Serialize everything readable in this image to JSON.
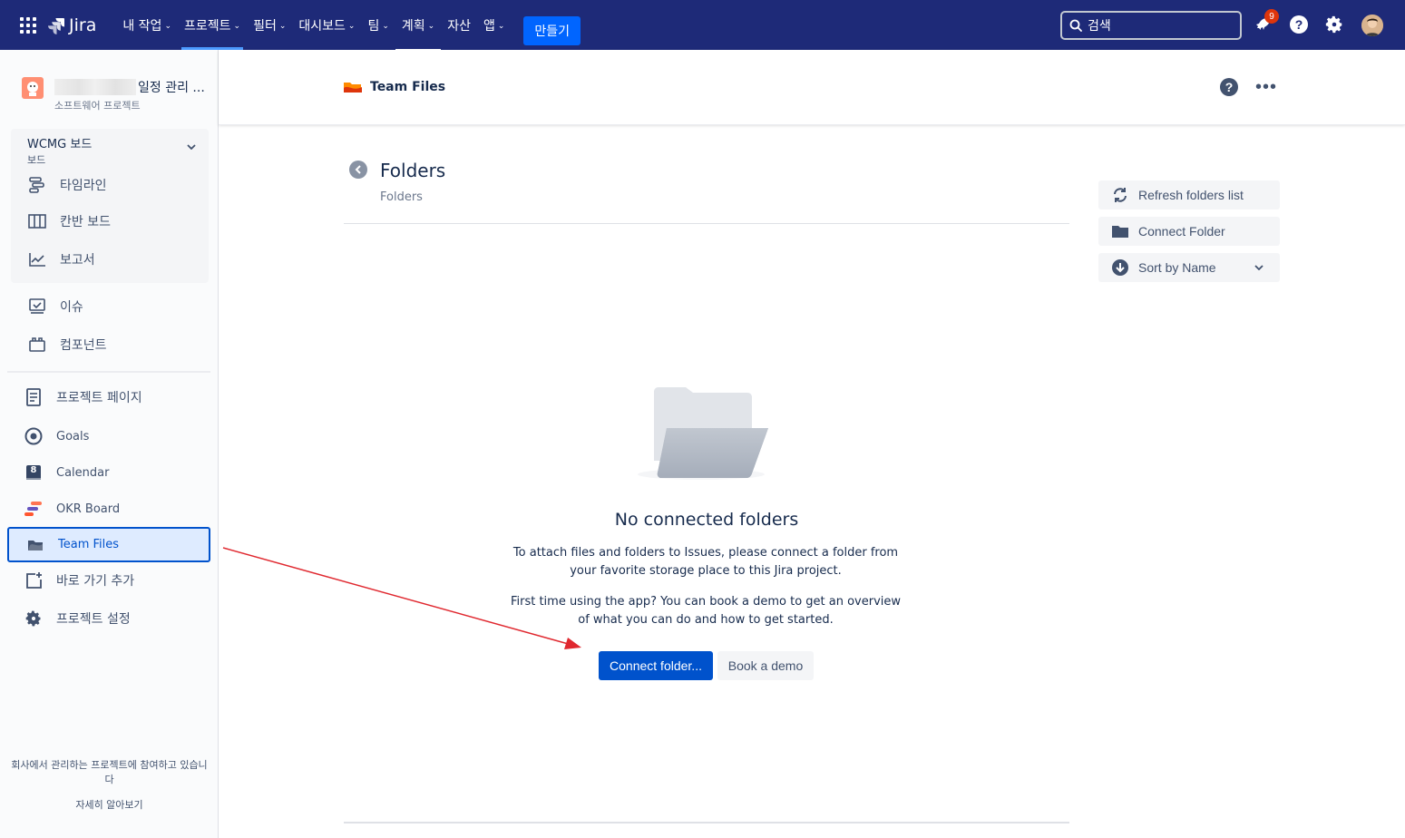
{
  "topnav": {
    "app_name": "Jira",
    "menu": [
      {
        "label": "내 작업",
        "chevron": true
      },
      {
        "label": "프로젝트",
        "chevron": true
      },
      {
        "label": "필터",
        "chevron": true
      },
      {
        "label": "대시보드",
        "chevron": true
      },
      {
        "label": "팀",
        "chevron": true
      },
      {
        "label": "계획",
        "chevron": true
      },
      {
        "label": "자산",
        "chevron": false
      },
      {
        "label": "앱",
        "chevron": true
      }
    ],
    "create_label": "만들기",
    "search_placeholder": "검색",
    "notification_count": "9",
    "accent": "#1e2a78"
  },
  "sidebar": {
    "project_title": "일정 관리 ...",
    "project_subtitle": "소프트웨어 프로젝트",
    "board": {
      "name": "WCMG 보드",
      "subtitle": "보드",
      "items": [
        {
          "label": "타임라인",
          "icon": "timeline-icon"
        },
        {
          "label": "칸반 보드",
          "icon": "board-icon"
        },
        {
          "label": "보고서",
          "icon": "reports-icon"
        }
      ]
    },
    "items": [
      {
        "label": "이슈",
        "icon": "issues-icon"
      },
      {
        "label": "컴포넌트",
        "icon": "components-icon"
      }
    ],
    "apps": [
      {
        "label": "프로젝트 페이지",
        "icon": "page-icon"
      },
      {
        "label": "Goals",
        "icon": "goals-icon"
      },
      {
        "label": "Calendar",
        "icon": "calendar-icon",
        "badge": "8"
      },
      {
        "label": "OKR Board",
        "icon": "okr-icon"
      },
      {
        "label": "Team Files",
        "icon": "team-files-icon",
        "selected": true
      },
      {
        "label": "바로 가기 추가",
        "icon": "add-shortcut-icon"
      },
      {
        "label": "프로젝트 설정",
        "icon": "settings-icon"
      }
    ],
    "footer_text": "회사에서 관리하는 프로젝트에 참여하고 있습니다",
    "footer_link": "자세히 알아보기"
  },
  "header": {
    "title": "Team Files",
    "help": "?",
    "more": "•••"
  },
  "main": {
    "heading": "Folders",
    "breadcrumb": "Folders",
    "actions": [
      {
        "label": "Refresh folders list",
        "icon": "refresh-icon"
      },
      {
        "label": "Connect Folder",
        "icon": "folder-icon"
      },
      {
        "label": "Sort by Name",
        "icon": "sort-icon",
        "chevron": true
      }
    ],
    "empty": {
      "title": "No connected folders",
      "line1": "To attach files and folders to Issues, please connect a folder from",
      "line2": "your favorite storage place to this Jira project.",
      "line3": "First time using the app? You can book a demo to get an overview",
      "line4": "of what you can do and how to get started.",
      "primary_button": "Connect folder...",
      "secondary_button": "Book a demo"
    }
  },
  "annotation": {
    "arrow_color": "#e0282f"
  }
}
